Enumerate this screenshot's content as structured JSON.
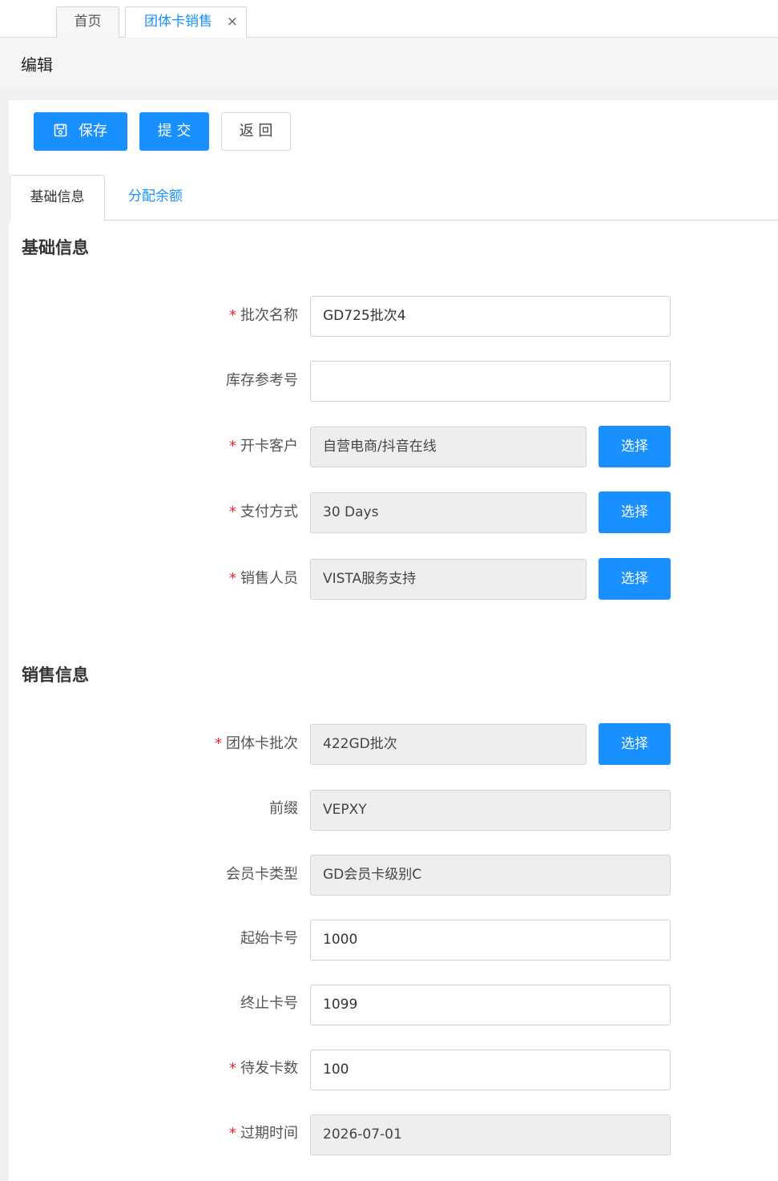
{
  "tabs": {
    "home": "首页",
    "active": "团体卡销售",
    "close": "×"
  },
  "header": {
    "title": "编辑"
  },
  "toolbar": {
    "save": "保存",
    "submit": "提 交",
    "back": "返 回"
  },
  "inner_tabs": {
    "basic": "基础信息",
    "allocate": "分配余额"
  },
  "sections": {
    "basic": "基础信息",
    "sales": "销售信息"
  },
  "required_mark": "*",
  "fields": {
    "batch_name": {
      "label": "批次名称",
      "value": "GD725批次4"
    },
    "stock_ref": {
      "label": "库存参考号",
      "value": ""
    },
    "customer": {
      "label": "开卡客户",
      "value": "自营电商/抖音在线",
      "button": "选择"
    },
    "payment": {
      "label": "支付方式",
      "value": "30 Days",
      "button": "选择"
    },
    "salesperson": {
      "label": "销售人员",
      "value": "VISTA服务支持",
      "button": "选择"
    },
    "group_batch": {
      "label": "团体卡批次",
      "value": "422GD批次",
      "button": "选择"
    },
    "prefix": {
      "label": "前缀",
      "value": "VEPXY"
    },
    "card_type": {
      "label": "会员卡类型",
      "value": "GD会员卡级别C"
    },
    "start_no": {
      "label": "起始卡号",
      "value": "1000"
    },
    "end_no": {
      "label": "终止卡号",
      "value": "1099"
    },
    "pending_count": {
      "label": "待发卡数",
      "value": "100"
    },
    "expiry": {
      "label": "过期时间",
      "value": "2026-07-01"
    }
  }
}
